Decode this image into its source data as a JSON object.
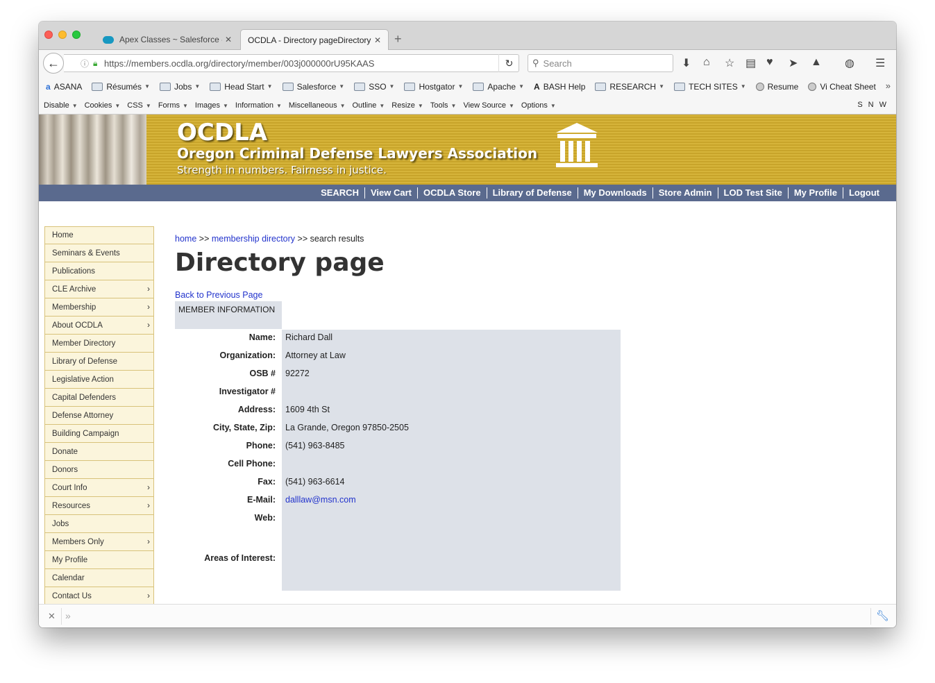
{
  "browser": {
    "tabs": [
      {
        "label": "Apex Classes ~ Salesforce - E"
      },
      {
        "label": "OCDLA - Directory pageDirectory"
      }
    ],
    "url": "https://members.ocdla.org/directory/member/003j000000rU95KAAS",
    "search_placeholder": "Search",
    "bookmarks": [
      "ASANA",
      "Résumés",
      "Jobs",
      "Head Start",
      "Salesforce",
      "SSO",
      "Hostgator",
      "Apache",
      "BASH Help",
      "RESEARCH",
      "TECH SITES",
      "Resume",
      "Vi Cheat Sheet"
    ],
    "dev_menu": [
      "Disable",
      "Cookies",
      "CSS",
      "Forms",
      "Images",
      "Information",
      "Miscellaneous",
      "Outline",
      "Resize",
      "Tools",
      "View Source",
      "Options"
    ],
    "dev_right": "SNW"
  },
  "banner": {
    "title": "OCDLA",
    "subtitle": "Oregon Criminal Defense Lawyers Association",
    "tagline": "Strength in numbers. Fairness in justice."
  },
  "topnav": [
    "SEARCH",
    "View Cart",
    "OCDLA Store",
    "Library of Defense",
    "My Downloads",
    "Store Admin",
    "LOD Test Site",
    "My Profile",
    "Logout"
  ],
  "sidebar": [
    {
      "label": "Home",
      "arrow": false
    },
    {
      "label": "Seminars & Events",
      "arrow": false
    },
    {
      "label": "Publications",
      "arrow": false
    },
    {
      "label": "CLE Archive",
      "arrow": true
    },
    {
      "label": "Membership",
      "arrow": true
    },
    {
      "label": "About OCDLA",
      "arrow": true
    },
    {
      "label": "Member Directory",
      "arrow": false
    },
    {
      "label": "Library of Defense",
      "arrow": false
    },
    {
      "label": "Legislative Action",
      "arrow": false
    },
    {
      "label": "Capital Defenders",
      "arrow": false
    },
    {
      "label": "Defense Attorney",
      "arrow": false
    },
    {
      "label": "Building Campaign",
      "arrow": false
    },
    {
      "label": "Donate",
      "arrow": false
    },
    {
      "label": "Donors",
      "arrow": false
    },
    {
      "label": "Court Info",
      "arrow": true
    },
    {
      "label": "Resources",
      "arrow": true
    },
    {
      "label": "Jobs",
      "arrow": false
    },
    {
      "label": "Members Only",
      "arrow": true
    },
    {
      "label": "My Profile",
      "arrow": false
    },
    {
      "label": "Calendar",
      "arrow": false
    },
    {
      "label": "Contact Us",
      "arrow": true
    }
  ],
  "breadcrumb": {
    "home": "home",
    "sep1": ">>",
    "directory": "membership directory",
    "sep2": ">>",
    "current": "search results"
  },
  "main": {
    "title": "Directory page",
    "back_link": "Back to Previous Page",
    "section_header": "MEMBER INFORMATION"
  },
  "member": [
    {
      "label": "Name:",
      "value": "Richard Dall"
    },
    {
      "label": "Organization:",
      "value": "Attorney at Law"
    },
    {
      "label": "OSB #",
      "value": "92272"
    },
    {
      "label": "Investigator #",
      "value": ""
    },
    {
      "label": "Address:",
      "value": "1609 4th St"
    },
    {
      "label": "City, State, Zip:",
      "value": "La Grande, Oregon 97850-2505"
    },
    {
      "label": "Phone:",
      "value": "(541) 963-8485"
    },
    {
      "label": "Cell Phone:",
      "value": ""
    },
    {
      "label": "Fax:",
      "value": "(541) 963-6614"
    },
    {
      "label": "E-Mail:",
      "value": "dalllaw@msn.com"
    },
    {
      "label": "Web:",
      "value": ""
    },
    {
      "label": "Areas of Interest:",
      "value": ""
    }
  ]
}
